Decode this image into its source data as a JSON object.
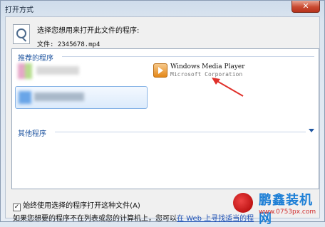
{
  "window": {
    "title": "打开方式"
  },
  "prompt": "选择您想用来打开此文件的程序:",
  "file": {
    "label": "文件:",
    "name": "2345678.mp4"
  },
  "groups": {
    "recommended": "推荐的程序",
    "other": "其他程序"
  },
  "programs": [
    {
      "name": "Windows Media Player",
      "publisher": "Microsoft Corporation"
    }
  ],
  "options": {
    "always_use": "始终使用选择的程序打开这种文件(A)",
    "checked": true
  },
  "footer": {
    "text": "如果您想要的程序不在列表或您的计算机上，您可以",
    "link": "在 Web 上寻找适当的程"
  },
  "watermark": {
    "brand": "鹏鑫装机网",
    "url": "www.0753px.com"
  },
  "colors": {
    "link": "#1c4fb3",
    "group": "#1f55a0",
    "arrow": "#e0302a"
  }
}
